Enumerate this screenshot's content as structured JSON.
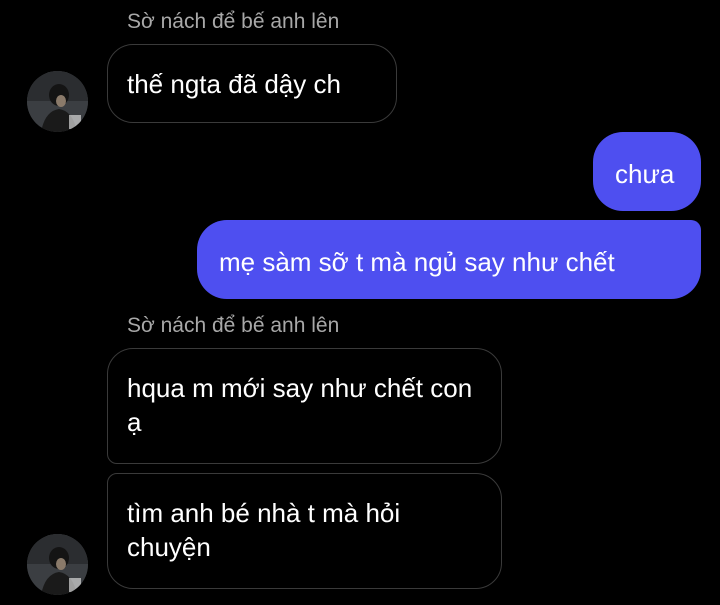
{
  "chat": {
    "group1": {
      "sender": "Sờ nách để bế anh lên",
      "messages": [
        "thế ngta đã dậy ch"
      ]
    },
    "outgoing": [
      "chưa",
      "mẹ sàm sỡ t mà ngủ say như chết"
    ],
    "group2": {
      "sender": "Sờ nách để bế anh lên",
      "messages": [
        "hqua m mới say như chết con ạ",
        "tìm anh bé nhà t mà hỏi chuyện"
      ]
    }
  },
  "colors": {
    "outgoing_bubble": "#4e4ff0",
    "incoming_border": "#3a3a3a",
    "sender_text": "#a8a8a8",
    "background": "#000000"
  },
  "icons": {
    "avatar": "profile-photo-avatar"
  }
}
